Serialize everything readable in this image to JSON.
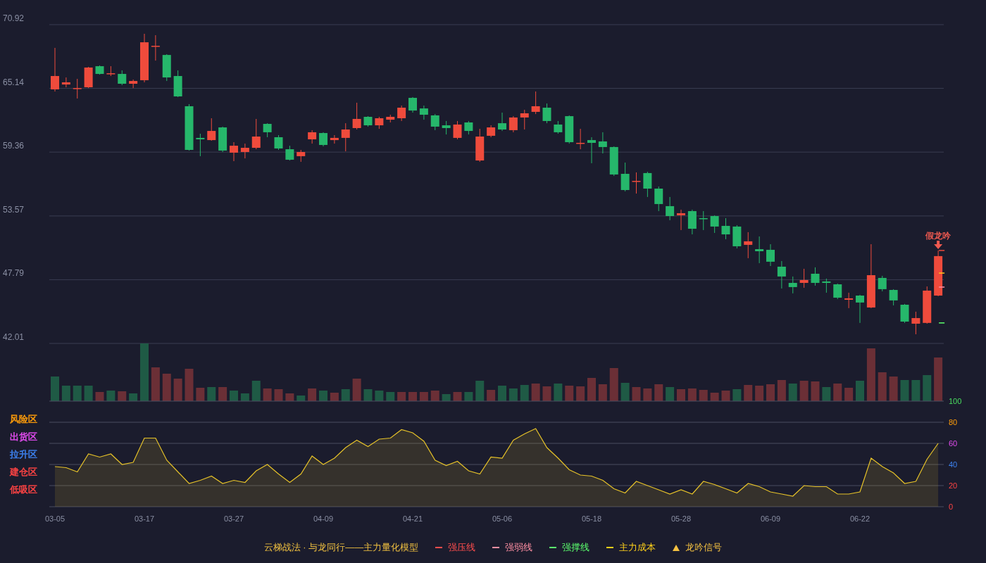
{
  "price_chart": {
    "chart_data": {
      "type": "candlestick",
      "grid": true,
      "ylim": [
        42.01,
        70.92
      ],
      "yticks": [
        {
          "value": 70.92,
          "label": "70.92"
        },
        {
          "value": 65.14,
          "label": "65.14"
        },
        {
          "value": 59.36,
          "label": "59.36"
        },
        {
          "value": 53.57,
          "label": "53.57"
        },
        {
          "value": 47.79,
          "label": "47.79"
        },
        {
          "value": 42.01,
          "label": "42.01"
        }
      ],
      "categories": [
        null,
        null,
        null,
        null,
        null,
        null,
        null,
        null,
        null,
        null,
        null,
        null,
        null,
        null,
        null,
        null,
        null,
        null,
        null,
        null,
        null,
        null,
        null,
        null,
        null,
        null,
        null,
        null,
        null,
        null,
        null,
        null,
        null,
        null,
        null,
        null,
        null,
        null,
        null,
        null,
        null,
        null,
        null,
        null,
        null,
        null,
        null,
        null,
        null,
        null,
        null,
        null,
        null,
        null,
        null,
        null,
        null,
        null,
        null,
        null,
        null,
        null,
        null,
        null,
        null,
        null,
        null,
        null,
        null,
        null,
        null,
        null,
        null,
        null,
        null,
        null,
        null,
        null,
        null,
        null
      ],
      "ohlc": [
        [
          65.05,
          68.81,
          64.86,
          66.26
        ],
        [
          65.49,
          66.13,
          65.24,
          65.69
        ],
        [
          65.17,
          66.0,
          64.22,
          65.17
        ],
        [
          65.24,
          67.09,
          65.17,
          67.03
        ],
        [
          67.15,
          67.22,
          66.39,
          66.45
        ],
        [
          66.51,
          67.15,
          66.26,
          66.51
        ],
        [
          66.45,
          66.77,
          65.43,
          65.56
        ],
        [
          65.56,
          65.94,
          65.17,
          65.81
        ],
        [
          65.88,
          70.09,
          65.69,
          69.32
        ],
        [
          69.0,
          69.96,
          67.66,
          69.0
        ],
        [
          68.17,
          68.24,
          65.81,
          66.13
        ],
        [
          66.26,
          66.77,
          64.35,
          64.41
        ],
        [
          63.52,
          63.71,
          59.5,
          59.56
        ],
        [
          60.65,
          61.03,
          58.99,
          60.52
        ],
        [
          60.45,
          62.43,
          60.39,
          61.28
        ],
        [
          61.6,
          61.67,
          59.37,
          59.5
        ],
        [
          59.31,
          60.26,
          58.54,
          59.94
        ],
        [
          59.37,
          60.13,
          58.79,
          59.75
        ],
        [
          59.75,
          62.37,
          59.62,
          60.77
        ],
        [
          61.92,
          61.98,
          60.71,
          61.16
        ],
        [
          60.71,
          60.9,
          59.56,
          59.69
        ],
        [
          59.62,
          59.94,
          58.6,
          58.67
        ],
        [
          58.99,
          59.56,
          58.48,
          59.37
        ],
        [
          60.52,
          61.35,
          60.13,
          61.16
        ],
        [
          61.09,
          61.16,
          59.88,
          60.01
        ],
        [
          60.45,
          60.9,
          60.13,
          60.65
        ],
        [
          60.65,
          61.98,
          59.43,
          61.41
        ],
        [
          61.54,
          63.84,
          61.41,
          62.37
        ],
        [
          62.56,
          62.62,
          61.67,
          61.79
        ],
        [
          61.79,
          62.56,
          61.47,
          62.43
        ],
        [
          62.3,
          62.75,
          62.05,
          62.56
        ],
        [
          62.43,
          63.58,
          62.18,
          63.39
        ],
        [
          64.28,
          64.35,
          62.94,
          63.13
        ],
        [
          63.32,
          63.58,
          62.3,
          62.75
        ],
        [
          62.69,
          62.81,
          61.35,
          61.67
        ],
        [
          61.79,
          62.18,
          60.96,
          61.54
        ],
        [
          60.65,
          62.18,
          60.52,
          61.86
        ],
        [
          62.05,
          62.18,
          60.96,
          61.28
        ],
        [
          58.6,
          61.47,
          58.48,
          60.77
        ],
        [
          60.84,
          61.79,
          60.71,
          61.6
        ],
        [
          61.98,
          62.94,
          61.28,
          61.41
        ],
        [
          61.35,
          62.62,
          61.16,
          62.5
        ],
        [
          62.5,
          63.2,
          61.41,
          62.88
        ],
        [
          63.01,
          64.86,
          62.81,
          63.52
        ],
        [
          63.39,
          63.77,
          61.98,
          62.18
        ],
        [
          61.86,
          62.18,
          61.03,
          61.16
        ],
        [
          62.62,
          62.69,
          60.13,
          60.26
        ],
        [
          60.13,
          61.47,
          59.62,
          60.2
        ],
        [
          60.45,
          60.71,
          58.35,
          60.2
        ],
        [
          60.33,
          61.16,
          59.24,
          59.82
        ],
        [
          59.82,
          59.88,
          57.2,
          57.33
        ],
        [
          57.39,
          58.41,
          55.8,
          55.92
        ],
        [
          56.69,
          57.52,
          55.6,
          56.75
        ],
        [
          57.46,
          57.58,
          55.29,
          56.05
        ],
        [
          56.05,
          56.24,
          54.01,
          54.65
        ],
        [
          54.46,
          55.29,
          53.18,
          53.56
        ],
        [
          53.63,
          54.14,
          52.29,
          53.82
        ],
        [
          54.01,
          54.14,
          51.9,
          52.41
        ],
        [
          53.37,
          54.01,
          52.29,
          53.31
        ],
        [
          53.56,
          53.63,
          52.03,
          52.61
        ],
        [
          52.67,
          53.37,
          51.46,
          51.9
        ],
        [
          52.61,
          52.73,
          50.63,
          50.82
        ],
        [
          50.95,
          52.1,
          49.74,
          51.27
        ],
        [
          50.56,
          51.71,
          49.29,
          50.37
        ],
        [
          50.5,
          51.01,
          49.03,
          49.42
        ],
        [
          48.97,
          49.48,
          46.99,
          48.08
        ],
        [
          47.5,
          48.08,
          46.55,
          47.12
        ],
        [
          47.5,
          48.78,
          47.06,
          47.76
        ],
        [
          48.33,
          48.91,
          47.25,
          47.5
        ],
        [
          47.63,
          47.89,
          46.61,
          47.5
        ],
        [
          47.37,
          47.44,
          46.03,
          46.16
        ],
        [
          45.97,
          46.61,
          45.21,
          46.1
        ],
        [
          46.35,
          46.42,
          43.87,
          45.72
        ],
        [
          45.27,
          51.01,
          45.21,
          48.2
        ],
        [
          47.95,
          48.14,
          46.74,
          46.93
        ],
        [
          46.86,
          46.93,
          45.46,
          45.91
        ],
        [
          45.52,
          45.59,
          43.87,
          43.99
        ],
        [
          43.8,
          44.89,
          42.84,
          44.31
        ],
        [
          43.87,
          47.18,
          43.8,
          46.8
        ],
        [
          46.35,
          50.44,
          46.29,
          49.93
        ]
      ]
    },
    "signal": {
      "text": "假龙吟",
      "color": "#f05a50"
    }
  },
  "indicator": {
    "zones": [
      {
        "label": "风险区",
        "color": "#ff9d0a"
      },
      {
        "label": "出货区",
        "color": "#e24cf0"
      },
      {
        "label": "拉升区",
        "color": "#3d82f0"
      },
      {
        "label": "建仓区",
        "color": "#ff4444"
      },
      {
        "label": "低吸区",
        "color": "#ff4444"
      }
    ],
    "chart_data": {
      "type": "area",
      "grid": true,
      "ylim": [
        0,
        100
      ],
      "yticks": [
        0,
        20,
        40,
        60,
        80,
        100
      ],
      "categories": [
        "03-05",
        null,
        null,
        null,
        null,
        null,
        null,
        null,
        "03-17",
        null,
        null,
        null,
        null,
        null,
        null,
        null,
        "03-27",
        null,
        null,
        null,
        null,
        null,
        null,
        null,
        "04-09",
        null,
        null,
        null,
        null,
        null,
        null,
        null,
        "04-21",
        null,
        null,
        null,
        null,
        null,
        null,
        null,
        "05-06",
        null,
        null,
        null,
        null,
        null,
        null,
        null,
        "05-18",
        null,
        null,
        null,
        null,
        null,
        null,
        null,
        "05-28",
        null,
        null,
        null,
        null,
        null,
        null,
        null,
        "06-09",
        null,
        null,
        null,
        null,
        null,
        null,
        null,
        "06-22",
        null,
        null,
        null,
        null,
        null,
        null,
        null
      ],
      "series": [
        {
          "color": "#e6c229",
          "values": [
            38,
            37,
            33,
            50,
            47,
            50,
            40,
            42,
            65,
            65,
            44,
            33,
            22,
            25,
            29,
            22,
            25,
            23,
            34,
            40,
            31,
            23,
            31,
            48,
            40,
            46,
            56,
            63,
            57,
            64,
            65,
            73,
            70,
            62,
            44,
            39,
            43,
            34,
            31,
            47,
            46,
            63,
            69,
            74,
            56,
            46,
            35,
            30,
            29,
            25,
            17,
            13,
            24,
            20,
            16,
            12,
            16,
            12,
            24,
            21,
            17,
            13,
            22,
            19,
            14,
            12,
            10,
            20,
            19,
            19,
            12,
            12,
            14,
            46,
            38,
            32,
            22,
            24,
            45,
            60
          ]
        }
      ]
    }
  },
  "legend": {
    "title": "云梯战法 · 与龙同行——主力量化模型",
    "items": [
      {
        "kind": "line",
        "label": "强压线",
        "color": "#ff4d4d"
      },
      {
        "kind": "dashed",
        "label": "强弱线",
        "color": "#ff8fa3"
      },
      {
        "kind": "line",
        "label": "强撑线",
        "color": "#5cff6e"
      },
      {
        "kind": "dashed",
        "label": "主力成本",
        "color": "#ffd11a"
      },
      {
        "kind": "triangle",
        "label": "龙吟信号",
        "color": "#f5c242"
      }
    ]
  }
}
